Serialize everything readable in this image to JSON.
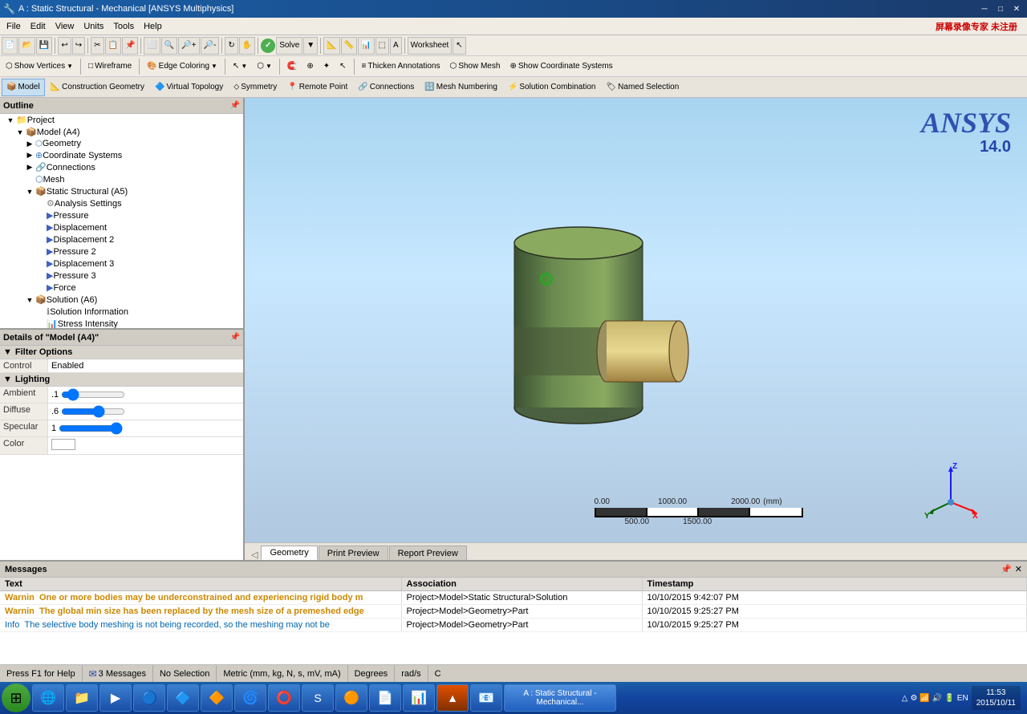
{
  "titlebar": {
    "title": "A : Static Structural - Mechanical [ANSYS Multiphysics]",
    "buttons": [
      "─",
      "□",
      "✕"
    ]
  },
  "menubar": {
    "items": [
      "File",
      "Edit",
      "View",
      "Units",
      "Tools",
      "Help"
    ],
    "ansys_promo": "屏幕录像专家 未注册"
  },
  "toolbar1": {
    "solve_label": "Solve",
    "worksheet_label": "Worksheet"
  },
  "ctx_toolbar": {
    "show_vertices": "Show Vertices",
    "wireframe": "Wireframe",
    "edge_coloring": "Edge Coloring",
    "thicken_annotations": "Thicken Annotations",
    "show_mesh": "Show Mesh",
    "show_coordinate_systems": "Show Coordinate Systems"
  },
  "model_toolbar": {
    "items": [
      "Model",
      "Construction Geometry",
      "Virtual Topology",
      "Symmetry",
      "Remote Point",
      "Connections",
      "Mesh Numbering",
      "Solution Combination",
      "Named Selection"
    ]
  },
  "outline": {
    "title": "Outline",
    "tree": [
      {
        "label": "Project",
        "indent": 0,
        "type": "folder",
        "icon": "📁"
      },
      {
        "label": "Model (A4)",
        "indent": 1,
        "type": "folder",
        "icon": "📦"
      },
      {
        "label": "Geometry",
        "indent": 2,
        "type": "item",
        "icon": "⬡"
      },
      {
        "label": "Coordinate Systems",
        "indent": 2,
        "type": "item",
        "icon": "⊕"
      },
      {
        "label": "Connections",
        "indent": 2,
        "type": "item",
        "icon": "🔗"
      },
      {
        "label": "Mesh",
        "indent": 2,
        "type": "item",
        "icon": "⬡"
      },
      {
        "label": "Static Structural (A5)",
        "indent": 2,
        "type": "folder",
        "icon": "📦"
      },
      {
        "label": "Analysis Settings",
        "indent": 3,
        "type": "item",
        "icon": "⚙"
      },
      {
        "label": "Pressure",
        "indent": 3,
        "type": "item",
        "icon": "▶"
      },
      {
        "label": "Displacement",
        "indent": 3,
        "type": "item",
        "icon": "▶"
      },
      {
        "label": "Displacement 2",
        "indent": 3,
        "type": "item",
        "icon": "▶"
      },
      {
        "label": "Pressure 2",
        "indent": 3,
        "type": "item",
        "icon": "▶"
      },
      {
        "label": "Displacement 3",
        "indent": 3,
        "type": "item",
        "icon": "▶"
      },
      {
        "label": "Pressure 3",
        "indent": 3,
        "type": "item",
        "icon": "▶"
      },
      {
        "label": "Force",
        "indent": 3,
        "type": "item",
        "icon": "▶"
      },
      {
        "label": "Solution (A6)",
        "indent": 2,
        "type": "folder",
        "icon": "📦"
      },
      {
        "label": "Solution Information",
        "indent": 3,
        "type": "item",
        "icon": "ℹ"
      },
      {
        "label": "Stress Intensity",
        "indent": 3,
        "type": "item",
        "icon": "📊"
      }
    ]
  },
  "details": {
    "title": "Details of \"Model (A4)\"",
    "sections": [
      {
        "name": "Filter Options",
        "rows": [
          {
            "label": "Control",
            "value": "Enabled"
          }
        ]
      },
      {
        "name": "Lighting",
        "rows": [
          {
            "label": "Ambient",
            "value": ".1"
          },
          {
            "label": "Diffuse",
            "value": ".6"
          },
          {
            "label": "Specular",
            "value": "1"
          },
          {
            "label": "Color",
            "value": ""
          }
        ]
      }
    ]
  },
  "tabs": [
    "Geometry",
    "Print Preview",
    "Report Preview"
  ],
  "active_tab": "Geometry",
  "messages": {
    "title": "Messages",
    "columns": [
      "Text",
      "Association",
      "Timestamp"
    ],
    "rows": [
      {
        "level": "Warnin",
        "text": "One or more bodies may be underconstrained and experiencing rigid body m",
        "association": "Project>Model>Static Structural>Solution",
        "timestamp": "10/10/2015 9:42:07 PM"
      },
      {
        "level": "Warnin",
        "text": "The global min size has been replaced by the mesh size of a premeshed edge",
        "association": "Project>Model>Geometry>Part",
        "timestamp": "10/10/2015 9:25:27 PM"
      },
      {
        "level": "Info",
        "text": "The selective body meshing is not being recorded, so the meshing may not be",
        "association": "Project>Model>Geometry>Part",
        "timestamp": "10/10/2015 9:25:27 PM"
      }
    ]
  },
  "statusbar": {
    "help": "Press F1 for Help",
    "messages_count": "3 Messages",
    "selection": "No Selection",
    "units": "Metric (mm, kg, N, s, mV, mA)",
    "degrees": "Degrees",
    "radians": "rad/s",
    "extra": "C"
  },
  "taskbar": {
    "time": "11:53",
    "date": "2015/10/11",
    "app_label": "A : Static Structural - Mechanical..."
  },
  "scale": {
    "values": [
      "0.00",
      "500.00",
      "1000.00",
      "1500.00",
      "2000.00"
    ],
    "unit": "(mm)"
  },
  "ansys": {
    "logo": "ANSYS",
    "version": "14.0"
  }
}
